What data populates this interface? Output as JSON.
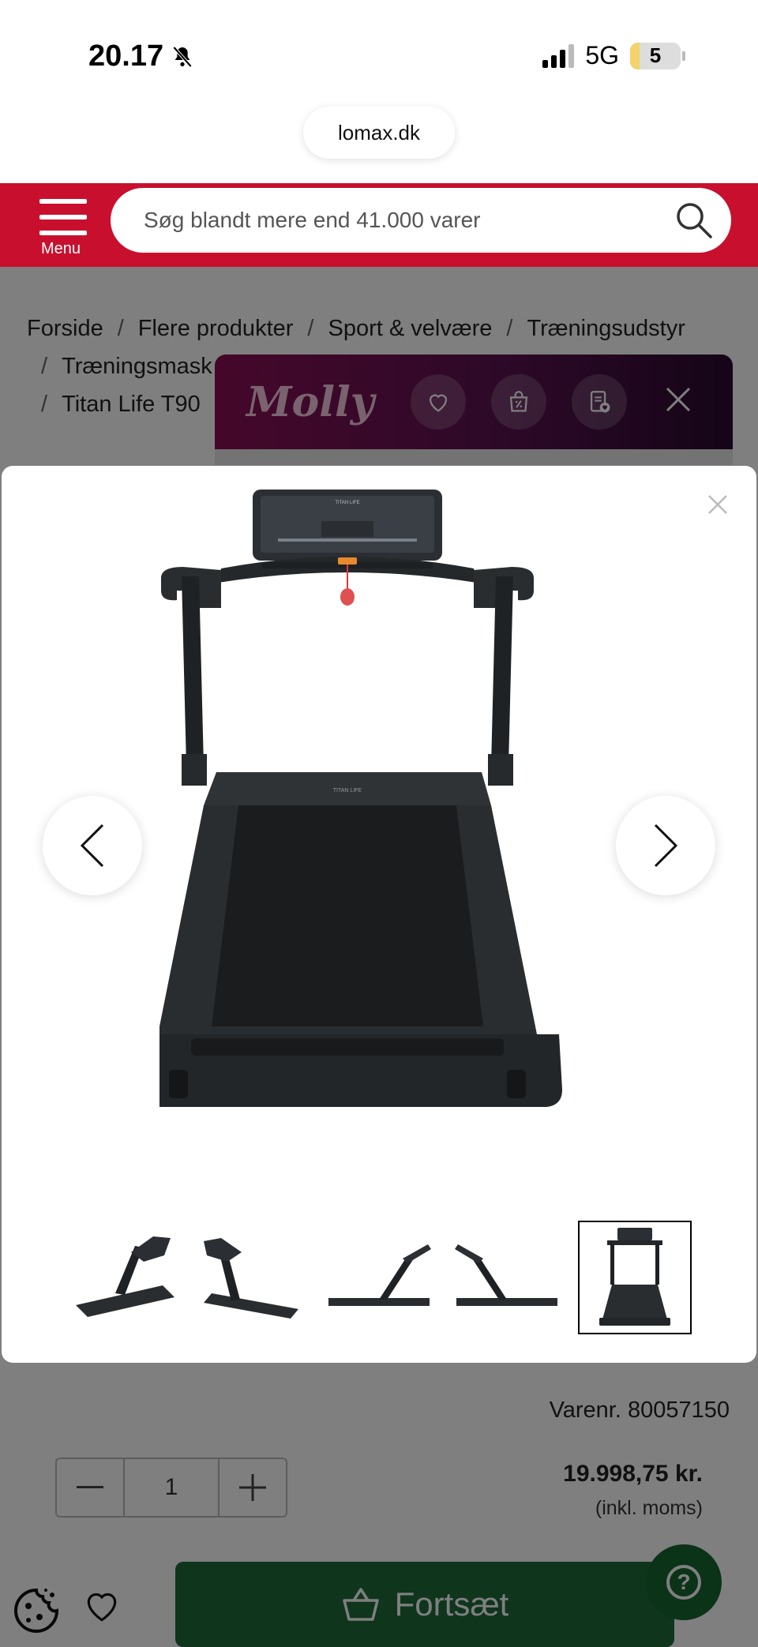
{
  "status_bar": {
    "time": "20.17",
    "network": "5G",
    "battery": "5"
  },
  "browser": {
    "url": "lomax.dk"
  },
  "header": {
    "menu_label": "Menu",
    "search_placeholder": "Søg blandt mere end 41.000 varer",
    "brand_color": "#c8102e"
  },
  "breadcrumb": {
    "items": [
      "Forside",
      "Flere produkter",
      "Sport & velvære",
      "Træningsudstyr",
      "Træningsmask",
      "Titan Life T90"
    ],
    "separator": "/"
  },
  "molly": {
    "logo": "Molly",
    "icons": [
      "heart-icon",
      "bag-percent-icon",
      "list-heart-icon",
      "close-icon"
    ]
  },
  "gallery": {
    "thumbnails": [
      "treadmill-angle-left",
      "treadmill-angle-right",
      "treadmill-side-left",
      "treadmill-side-right",
      "treadmill-front"
    ],
    "active_index": 4,
    "main_image": "Titan Life treadmill front view",
    "console_brand": "TITAN LIFE"
  },
  "product": {
    "item_number": "Varenr. 80057150",
    "quantity": "1",
    "price": "19.998,75 kr.",
    "vat_note": "(inkl. moms)"
  },
  "cta": {
    "label": "Fortsæt",
    "color": "#1e6b3a"
  },
  "help": {
    "label": "?"
  }
}
